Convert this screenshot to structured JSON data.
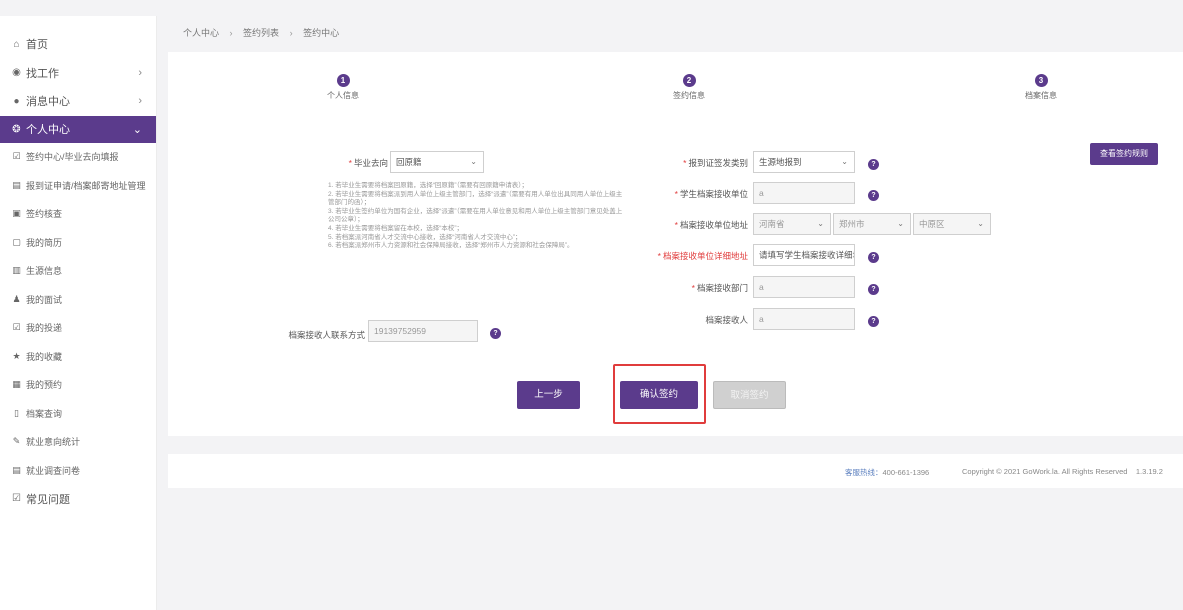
{
  "sidebar": {
    "items": [
      {
        "icon": "home-icon",
        "glyph": "⌂",
        "label": "首页",
        "top": true
      },
      {
        "icon": "search-job-icon",
        "glyph": "◉",
        "label": "找工作",
        "chevron": "›",
        "top": true
      },
      {
        "icon": "message-icon",
        "glyph": "●",
        "label": "消息中心",
        "chevron": "›",
        "top": true
      },
      {
        "icon": "user-icon",
        "glyph": "❂",
        "label": "个人中心",
        "chevron": "⌄",
        "active": true
      },
      {
        "icon": "edit-icon",
        "glyph": "☑",
        "label": "签约中心/毕业去向填报",
        "sub": true
      },
      {
        "icon": "card-icon",
        "glyph": "▤",
        "label": "报到证申请/档案邮寄地址管理",
        "sub": true
      },
      {
        "icon": "document-icon",
        "glyph": "▣",
        "label": "签约核查",
        "sub": true
      },
      {
        "icon": "resume-icon",
        "glyph": "▢",
        "label": "我的简历",
        "sub": true
      },
      {
        "icon": "student-info-icon",
        "glyph": "▥",
        "label": "生源信息",
        "sub": true
      },
      {
        "icon": "interview-icon",
        "glyph": "♟",
        "label": "我的面试",
        "sub": true
      },
      {
        "icon": "delivery-icon",
        "glyph": "☑",
        "label": "我的投递",
        "sub": true
      },
      {
        "icon": "star-icon",
        "glyph": "★",
        "label": "我的收藏",
        "sub": true
      },
      {
        "icon": "calendar-icon",
        "glyph": "▦",
        "label": "我的预约",
        "sub": true
      },
      {
        "icon": "file-query-icon",
        "glyph": "▯",
        "label": "档案查询",
        "sub": true
      },
      {
        "icon": "stats-icon",
        "glyph": "✎",
        "label": "就业意向统计",
        "sub": true
      },
      {
        "icon": "survey-icon",
        "glyph": "▤",
        "label": "就业调查问卷",
        "sub": true
      },
      {
        "icon": "faq-icon",
        "glyph": "☑",
        "label": "常见问题",
        "top": true
      }
    ]
  },
  "breadcrumb": {
    "items": [
      "个人中心",
      "签约列表",
      "签约中心"
    ],
    "separator": "›"
  },
  "steps": [
    {
      "num": "1",
      "label": "个人信息"
    },
    {
      "num": "2",
      "label": "签约信息"
    },
    {
      "num": "3",
      "label": "档案信息"
    }
  ],
  "rule_button": "查看签约规则",
  "form": {
    "destination_label": "毕业去向",
    "destination_value": "回原籍",
    "notes": [
      "1. 若毕业生需要将档案回原籍，选择“回原籍”（需要有回原籍申请表）；",
      "2. 若毕业生需要将档案派到用人单位上级主管部门，选择“派遣”（需要有用人单位出具同用人单位上级主管部门的函）；",
      "3. 若毕业生签约单位为国有企业，选择“派遣”（需要在用人单位意见和用人单位上级主管部门意见处盖上公司公章）；",
      "4. 若毕业生需要将档案留在本校，选择“本校”；",
      "5. 若档案派河南省人才交流中心接收，选择“河南省人才交流中心”；",
      "6. 若档案派郑州市人力资源和社会保障局接收，选择“郑州市人力资源和社会保障局”。"
    ],
    "contact_label": "档案接收人联系方式",
    "contact_value": "19139752959",
    "cert_type_label": "报到证签发类别",
    "cert_type_value": "生源地报到",
    "unit_label": "学生档案接收单位",
    "unit_value": "a",
    "address_label": "档案接收单位地址",
    "province": "河南省",
    "city": "郑州市",
    "district": "中原区",
    "detail_address_label": "档案接收单位详细地址",
    "detail_address_placeholder": "请填写学生档案接收详细地址",
    "department_label": "档案接收部门",
    "department_value": "a",
    "receiver_label": "档案接收人",
    "receiver_value": "a"
  },
  "buttons": {
    "prev": "上一步",
    "confirm": "确认签约",
    "cancel": "取消签约"
  },
  "footer": {
    "hotline_label": "客服热线：",
    "hotline": "400-661-1396",
    "copyright": "Copyright © 2021 GoWork.la. All Rights Reserved",
    "version": "1.3.19.2"
  },
  "colors": {
    "brand": "#5b3b8c",
    "required": "#e03c3c",
    "highlight": "#e03c3c"
  }
}
